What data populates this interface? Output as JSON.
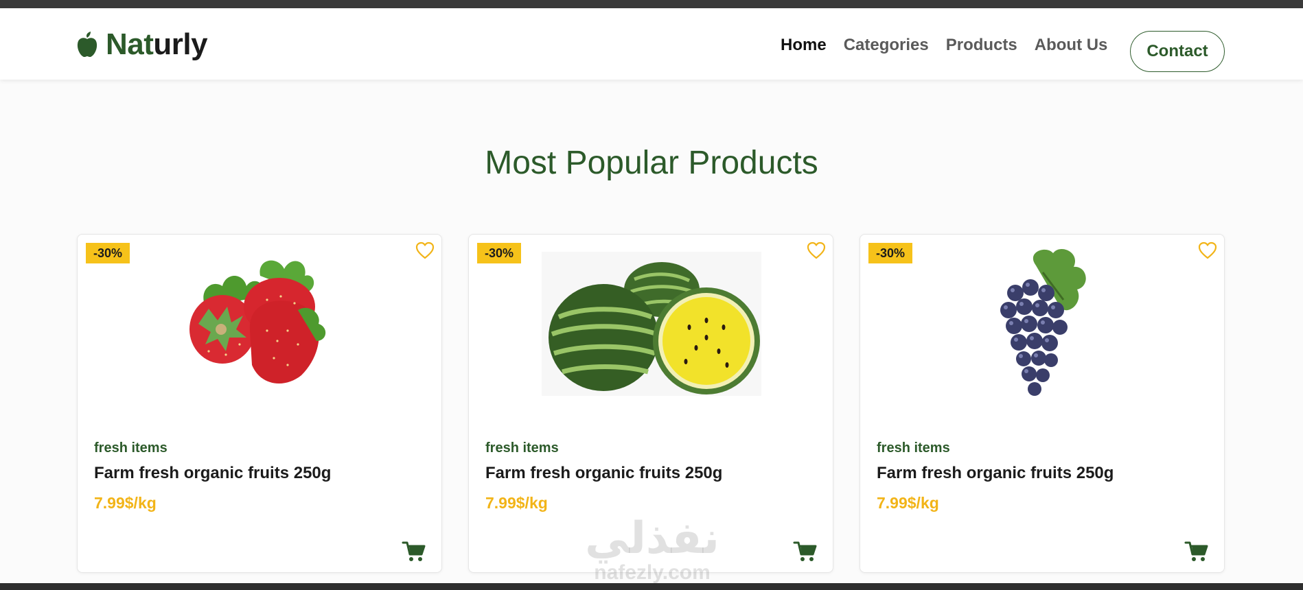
{
  "brand": {
    "name_part1": "Nat",
    "name_part2": "urly",
    "logo_icon": "apple-icon"
  },
  "nav": {
    "links": [
      {
        "label": "Home",
        "active": true
      },
      {
        "label": "Categories",
        "active": false
      },
      {
        "label": "Products",
        "active": false
      },
      {
        "label": "About Us",
        "active": false
      }
    ],
    "contact_label": "Contact"
  },
  "section": {
    "title": "Most Popular Products"
  },
  "products": [
    {
      "badge": "-30%",
      "image": "strawberries",
      "category": "fresh items",
      "title": "Farm fresh organic fruits 250g",
      "price": "7.99$/kg"
    },
    {
      "badge": "-30%",
      "image": "watermelon",
      "category": "fresh items",
      "title": "Farm fresh organic fruits 250g",
      "price": "7.99$/kg"
    },
    {
      "badge": "-30%",
      "image": "grapes",
      "category": "fresh items",
      "title": "Farm fresh organic fruits 250g",
      "price": "7.99$/kg"
    }
  ],
  "watermark": {
    "arabic": "نفذلي",
    "latin": "nafezly.com"
  },
  "colors": {
    "brand_green": "#2c5a2a",
    "badge_yellow": "#f6c21a",
    "price_gold": "#f2b418"
  }
}
